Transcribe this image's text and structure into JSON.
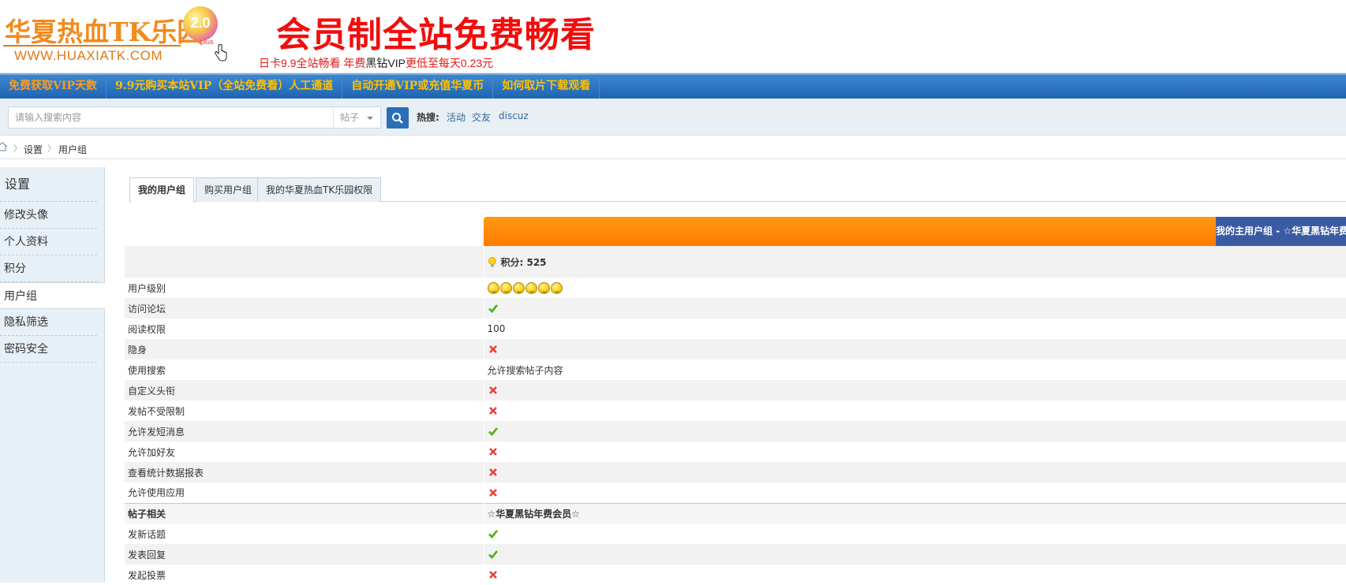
{
  "header": {
    "logo_text": "华夏热血TK乐园",
    "logo_url": "WWW.HUAXIATK.COM",
    "logo_badge": "2.0",
    "logo_plus": "plus",
    "ad_title": "会员制全站免费畅看",
    "ad_sub_a": "日卡9.9全站畅看  年费",
    "ad_sub_b": "黑钻VIP",
    "ad_sub_c": "更低至每天0.23元"
  },
  "nav": {
    "items": [
      {
        "label": "免费获取VIP天数"
      },
      {
        "label": "9.9元购买本站VIP（全站免费看）人工通道"
      },
      {
        "label": "自动开通VIP或充值华夏币"
      },
      {
        "label": "如何取片下载观看"
      }
    ]
  },
  "search": {
    "placeholder": "请输入搜索内容",
    "type": "帖子",
    "hot_label": "热搜:",
    "hot_links": [
      "活动",
      "交友",
      "discuz"
    ]
  },
  "breadcrumb": {
    "items": [
      "设置",
      "用户组"
    ]
  },
  "sidebar": {
    "title": "设置",
    "items": [
      {
        "label": "修改头像"
      },
      {
        "label": "个人资料"
      },
      {
        "label": "积分"
      },
      {
        "label": "用户组",
        "active": true
      },
      {
        "label": "隐私筛选"
      },
      {
        "label": "密码安全"
      }
    ]
  },
  "tabs": [
    {
      "label": "我的用户组",
      "active": true
    },
    {
      "label": "购买用户组"
    },
    {
      "label": "我的华夏热血TK乐园权限"
    }
  ],
  "group": {
    "title": "我的主用户组 - ☆华夏黑钻年费会员☆",
    "score_label": "积分: 525"
  },
  "rows": [
    {
      "label": "用户级别",
      "type": "stars",
      "count": 6
    },
    {
      "label": "访问论坛",
      "type": "ok"
    },
    {
      "label": "阅读权限",
      "type": "text",
      "value": "100"
    },
    {
      "label": "隐身",
      "type": "no"
    },
    {
      "label": "使用搜索",
      "type": "text",
      "value": "允许搜索帖子内容"
    },
    {
      "label": "自定义头衔",
      "type": "no"
    },
    {
      "label": "发帖不受限制",
      "type": "no"
    },
    {
      "label": "允许发短消息",
      "type": "ok"
    },
    {
      "label": "允许加好友",
      "type": "no"
    },
    {
      "label": "查看统计数据报表",
      "type": "no"
    },
    {
      "label": "允许使用应用",
      "type": "no"
    },
    {
      "label": "帖子相关",
      "type": "header",
      "value": "☆华夏黑钻年费会员☆"
    },
    {
      "label": "发新话题",
      "type": "ok"
    },
    {
      "label": "发表回复",
      "type": "ok"
    },
    {
      "label": "发起投票",
      "type": "no"
    }
  ],
  "colors": {
    "accent_orange": "#ff8a00",
    "nav_blue": "#2a6fb8",
    "ok_green": "#4caf1a",
    "no_red": "#e8413a"
  }
}
